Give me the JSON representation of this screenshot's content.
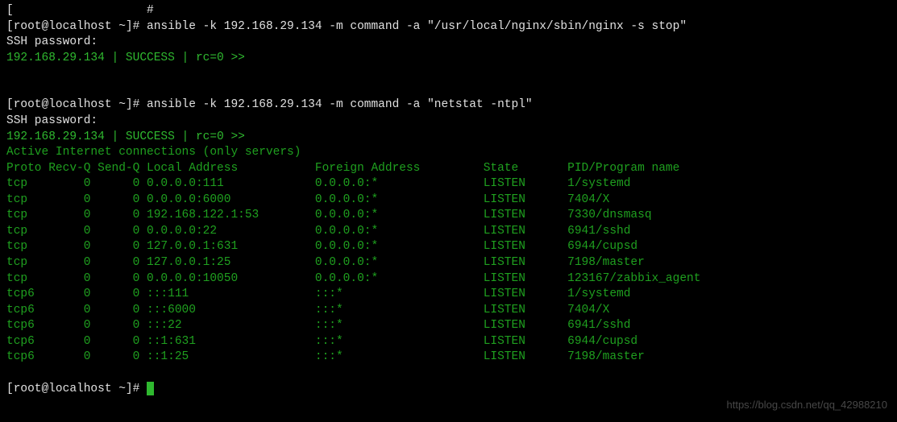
{
  "lines": {
    "truncated_top": "[                   #",
    "prompt1": "[root@localhost ~]# ",
    "cmd1": "ansible -k 192.168.29.134 -m command -a \"/usr/local/nginx/sbin/nginx -s stop\"",
    "sshpw": "SSH password:",
    "success1": "192.168.29.134 | SUCCESS | rc=0 >>",
    "blank": " ",
    "prompt2": "[root@localhost ~]# ",
    "cmd2": "ansible -k 192.168.29.134 -m command -a \"netstat -ntpl\"",
    "success2": "192.168.29.134 | SUCCESS | rc=0 >>",
    "header": "Active Internet connections (only servers)",
    "cols": "Proto Recv-Q Send-Q Local Address           Foreign Address         State       PID/Program name   ",
    "r1": "tcp        0      0 0.0.0.0:111             0.0.0.0:*               LISTEN      1/systemd           ",
    "r2": "tcp        0      0 0.0.0.0:6000            0.0.0.0:*               LISTEN      7404/X              ",
    "r3": "tcp        0      0 192.168.122.1:53        0.0.0.0:*               LISTEN      7330/dnsmasq        ",
    "r4": "tcp        0      0 0.0.0.0:22              0.0.0.0:*               LISTEN      6941/sshd           ",
    "r5": "tcp        0      0 127.0.0.1:631           0.0.0.0:*               LISTEN      6944/cupsd          ",
    "r6": "tcp        0      0 127.0.0.1:25            0.0.0.0:*               LISTEN      7198/master         ",
    "r7": "tcp        0      0 0.0.0.0:10050           0.0.0.0:*               LISTEN      123167/zabbix_agent ",
    "r8": "tcp6       0      0 :::111                  :::*                    LISTEN      1/systemd           ",
    "r9": "tcp6       0      0 :::6000                 :::*                    LISTEN      7404/X              ",
    "r10": "tcp6       0      0 :::22                   :::*                    LISTEN      6941/sshd           ",
    "r11": "tcp6       0      0 ::1:631                 :::*                    LISTEN      6944/cupsd          ",
    "r12": "tcp6       0      0 ::1:25                  :::*                    LISTEN      7198/master         ",
    "prompt3": "[root@localhost ~]# "
  },
  "watermark": "https://blog.csdn.net/qq_42988210"
}
